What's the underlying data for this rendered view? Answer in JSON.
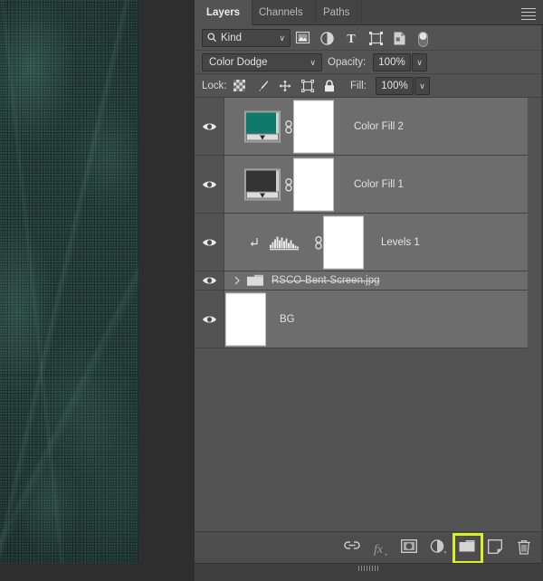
{
  "app": {
    "name": "Adobe Photoshop Layers Panel"
  },
  "panel": {
    "tabs": [
      {
        "id": "layers",
        "label": "Layers",
        "active": true
      },
      {
        "id": "channels",
        "label": "Channels",
        "active": false
      },
      {
        "id": "paths",
        "label": "Paths",
        "active": false
      }
    ],
    "menu_icon": "hamburger-menu-icon"
  },
  "filter": {
    "kind_label": "Kind",
    "search_icon": "search-icon",
    "caret": "∨",
    "icons": [
      {
        "name": "filter-pixel-layers-icon",
        "title": "Pixel Layers"
      },
      {
        "name": "filter-adjustment-layers-icon",
        "title": "Adjustment Layers"
      },
      {
        "name": "filter-type-layers-icon",
        "title": "Type Layers"
      },
      {
        "name": "filter-shape-layers-icon",
        "title": "Shape Layers"
      },
      {
        "name": "filter-smart-objects-icon",
        "title": "Smart Objects"
      },
      {
        "name": "filter-toggle-icon",
        "title": "Turn filtering on/off"
      }
    ]
  },
  "blend": {
    "mode": "Color Dodge",
    "opacity_label": "Opacity:",
    "opacity_value": "100%",
    "caret": "∨"
  },
  "lock": {
    "label": "Lock:",
    "fill_label": "Fill:",
    "fill_value": "100%",
    "caret": "∨",
    "icons": [
      {
        "name": "lock-transparent-pixels-icon"
      },
      {
        "name": "lock-image-pixels-icon"
      },
      {
        "name": "lock-position-icon"
      },
      {
        "name": "lock-artboard-nesting-icon"
      },
      {
        "name": "lock-all-icon"
      }
    ]
  },
  "layers": [
    {
      "id": "color-fill-2",
      "name": "Color Fill 2",
      "type": "fill",
      "visible": true,
      "selected": true,
      "swatch_color": "#0f7a6a",
      "linked": true,
      "has_mask": true,
      "mask_color": "#ffffff"
    },
    {
      "id": "color-fill-1",
      "name": "Color Fill 1",
      "type": "fill",
      "visible": true,
      "selected": true,
      "swatch_color": "#333333",
      "linked": true,
      "has_mask": true,
      "mask_color": "#ffffff"
    },
    {
      "id": "levels-1",
      "name": "Levels 1",
      "type": "adjustment-levels",
      "visible": true,
      "selected": true,
      "clipped": true,
      "linked": true,
      "has_mask": true,
      "mask_color": "#ffffff"
    },
    {
      "id": "rsco-bent-screen-group",
      "name": "RSCO-Bent-Screen.jpg",
      "type": "group",
      "visible": true,
      "selected": true,
      "expanded": false,
      "strikethrough": true
    },
    {
      "id": "bg",
      "name": "BG",
      "type": "pixel",
      "visible": true,
      "selected": true,
      "thumb_color": "#ffffff"
    }
  ],
  "bottom_toolbar": {
    "buttons": [
      {
        "name": "link-layers-button",
        "icon": "link-icon",
        "label": "Link layers",
        "highlighted": false
      },
      {
        "name": "layer-style-button",
        "icon": "fx-icon",
        "label": "Add a layer style",
        "highlighted": false
      },
      {
        "name": "add-layer-mask-button",
        "icon": "mask-icon",
        "label": "Add layer mask",
        "highlighted": false
      },
      {
        "name": "new-adjustment-layer-button",
        "icon": "half-circle-icon",
        "label": "New fill or adjustment layer",
        "highlighted": false
      },
      {
        "name": "new-group-button",
        "icon": "folder-icon",
        "label": "Create a new group",
        "highlighted": true
      },
      {
        "name": "new-layer-button",
        "icon": "new-layer-icon",
        "label": "Create a new layer",
        "highlighted": false
      },
      {
        "name": "delete-layer-button",
        "icon": "trash-icon",
        "label": "Delete layer",
        "highlighted": false
      }
    ],
    "highlight_color": "#d9f023"
  },
  "canvas": {
    "description": "Dark teal halftone textured image",
    "base_color": "#1b302b"
  }
}
